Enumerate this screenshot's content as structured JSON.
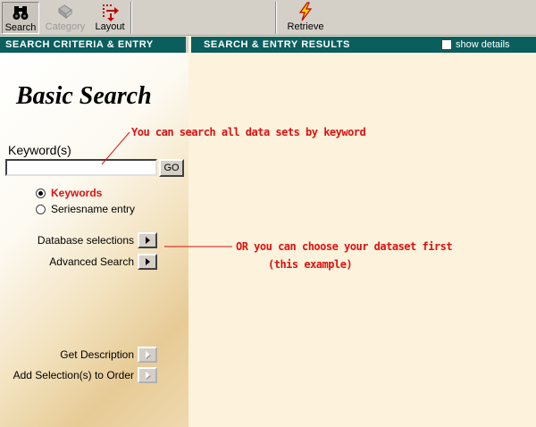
{
  "toolbar": {
    "search_label": "Search",
    "category_label": "Category",
    "layout_label": "Layout",
    "retrieve_label": "Retrieve"
  },
  "headers": {
    "left": "SEARCH CRITERIA  &  ENTRY",
    "right": "SEARCH & ENTRY RESULTS",
    "show_details_label": "show details",
    "show_details_checked": false
  },
  "search": {
    "title": "Basic Search",
    "keyword_label": "Keyword(s)",
    "keyword_value": "",
    "go_label": "GO",
    "radio_options": [
      {
        "label": "Keywords",
        "selected": true
      },
      {
        "label": "Seriesname entry",
        "selected": false
      }
    ],
    "actions": {
      "database_selections": "Database selections",
      "advanced_search": "Advanced Search",
      "get_description": "Get Description",
      "add_to_order": "Add Selection(s) to Order"
    }
  },
  "annotations": {
    "note1": "You can search all data sets by keyword",
    "note2": "OR you can choose your dataset first",
    "note3": "(this example)"
  },
  "colors": {
    "header_bg": "#0b5e5e",
    "annotation": "#e01010",
    "results_bg": "#fdf3dc"
  }
}
